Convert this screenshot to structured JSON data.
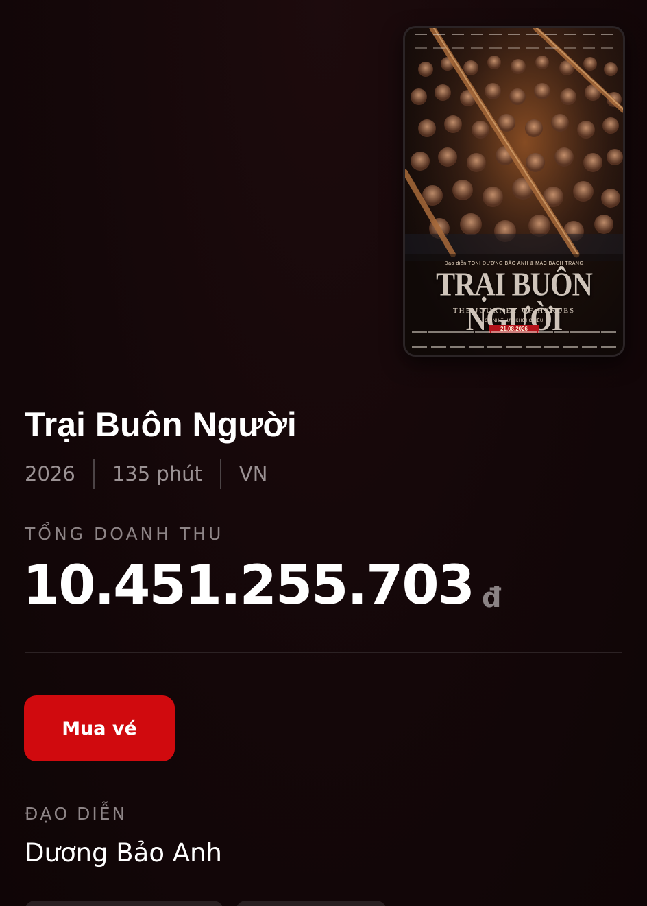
{
  "poster": {
    "director_credit": "Đạo diễn TONI ĐƯƠNG BẢO ANH & MẠC BÁCH TRANG",
    "title": "TRẠI BUÔN NGƯỜI",
    "subtitle": "THE JOURNEY OF HEROES",
    "release_label": "CHÍNH THỨC KHỞI CHIẾU",
    "release_date": "21.08.2026",
    "dominant_colors": [
      "#6a3a1e",
      "#2a1710",
      "#b3121a"
    ]
  },
  "movie": {
    "title": "Trại Buôn Người",
    "year": "2026",
    "duration": "135 phút",
    "country": "VN"
  },
  "revenue": {
    "label": "TỔNG DOANH THU",
    "value": "10.451.255.703",
    "currency": "đ"
  },
  "actions": {
    "buy_label": "Mua vé",
    "buy_color": "#d00a0e"
  },
  "director": {
    "label": "ĐẠO DIỄN",
    "name": "Dương Bảo Anh"
  }
}
